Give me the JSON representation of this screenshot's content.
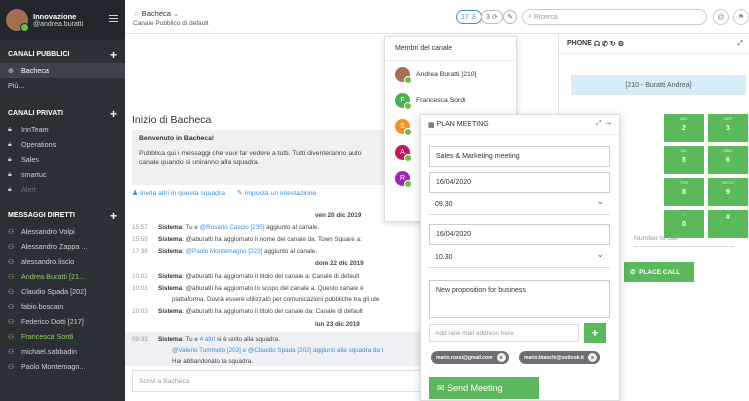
{
  "sidebar": {
    "org": "Innovazione",
    "user": "@andrea.buratti",
    "sections": {
      "public": "CANALI PUBBLICI",
      "private": "CANALI PRIVATI",
      "direct": "MESSAGGI DIRETTI"
    },
    "public_items": [
      "Bacheca",
      "Più..."
    ],
    "private_items": [
      "InnTeam",
      "Operations",
      "Sales",
      "smartuc",
      "Alert"
    ],
    "direct_items": [
      "Alessandro Volpi",
      "Alessandro Zappa ...",
      "alessandro.liscio",
      "Andrea Buratti [21...",
      "Claudio Spada [202]",
      "fabio.boscain",
      "Federico Dotti [217]",
      "Francesca Sordi",
      "michael.sabbadin",
      "Paolo Montemagn..."
    ]
  },
  "topbar": {
    "channel": "Bacheca",
    "subtitle": "Canale Pubblico di default",
    "members_count": "17",
    "threads_count": "3",
    "search_placeholder": "Ricerca"
  },
  "main": {
    "title": "Inizio di Bacheca",
    "welcome_title": "Benvenuto in Bacheca!",
    "welcome_text_1": "Pubblica qui i messaggi che vuoi far vedere a tutti. Tutti diventeranno auto",
    "welcome_text_2": "canale quando si uniranno alla squadra.",
    "invite_link": "Invita altri in questa squadra",
    "header_link": "Imposta un intestazione",
    "day1": "ven 20 dic 2019",
    "day2": "dom 22 dic 2019",
    "day3": "lun 23 dic 2019",
    "messages": [
      {
        "time": "15:57",
        "sender": "Sistema",
        "pre": ": Tu e ",
        "link": "@Rosario Cascio [235]",
        "post": " aggiunto al canale."
      },
      {
        "time": "15:59",
        "sender": "Sistema",
        "pre": ": @aburatti ha aggiornato il nome del canale da: Town Square a:",
        "link": "",
        "post": ""
      },
      {
        "time": "17:38",
        "sender": "Sistema",
        "pre": ": ",
        "link": "@Paolo Montemagno [223]",
        "post": " aggiunto al canale."
      },
      {
        "time": "10:02",
        "sender": "Sistema",
        "pre": ": @aburatti ha aggiornato il titolo del canale a: Canale di default",
        "link": "",
        "post": ""
      },
      {
        "time": "10:03",
        "sender": "Sistema",
        "pre": ": @aburatti ha aggiornato lo scopo del canale a: Questo canale è",
        "link": "",
        "post": ""
      },
      {
        "time": "",
        "sender": "",
        "pre": "piattaforma. Dovrà essere utilizzato per comunicazioni pubbliche tra gli ute",
        "link": "",
        "post": ""
      },
      {
        "time": "10:03",
        "sender": "Sistema",
        "pre": ": @aburatti ha aggiornato il titolo del canale da: Canale di default",
        "link": "",
        "post": ""
      },
      {
        "time": "09:33",
        "sender": "Sistema",
        "pre": ": Tu e ",
        "link": "4 altri",
        "post": " si è unito alla squadra."
      }
    ],
    "joined_line": "@Valerio Tummolo [203] e @Claudio Spada [202] aggiunti alla squadra da t",
    "left_line": "Hai abbandonato la squadra.",
    "compose_placeholder": "Scrivi a Bacheca"
  },
  "members_popup": {
    "title": "Membri del canale",
    "members": [
      {
        "name": "Andrea Buratti [210]",
        "initial": "",
        "color": "#a07050"
      },
      {
        "name": "Francesca Sordi",
        "initial": "F",
        "color": "#4caf50"
      },
      {
        "name": "",
        "initial": "S",
        "color": "#f0932b"
      },
      {
        "name": "",
        "initial": "A",
        "color": "#c2185b"
      },
      {
        "name": "",
        "initial": "R",
        "color": "#9c27b0"
      }
    ]
  },
  "plan_meeting": {
    "title": "PLAN MEETING",
    "subject": "Sales & Marketing meeting",
    "start_date": "16/04/2020",
    "start_time": "09.30",
    "end_date": "16/04/2020",
    "end_time": "10.30",
    "description": "New proposition for business",
    "mail_placeholder": "Add new mail address here",
    "chips": [
      "mario.rossi@gmail.com",
      "mario.bianchi@outlook.it"
    ],
    "send_label": "Send Meeting"
  },
  "phone": {
    "title": "PHONE",
    "line": "[210 - Buratti Andrea]",
    "keys": [
      {
        "n": "2",
        "l": "ABC"
      },
      {
        "n": "3",
        "l": "DEF"
      },
      {
        "n": "5",
        "l": "JKL"
      },
      {
        "n": "6",
        "l": "MNO"
      },
      {
        "n": "8",
        "l": "TUV"
      },
      {
        "n": "9",
        "l": "WXYZ"
      },
      {
        "n": "0",
        "l": "+"
      },
      {
        "n": "#",
        "l": ""
      }
    ],
    "number_placeholder": "Number to call",
    "place_call": "PLACE CALL"
  },
  "colors": {
    "accent": "#3a8fd8",
    "green": "#5cb85c",
    "sidebar": "#2b2f36"
  }
}
